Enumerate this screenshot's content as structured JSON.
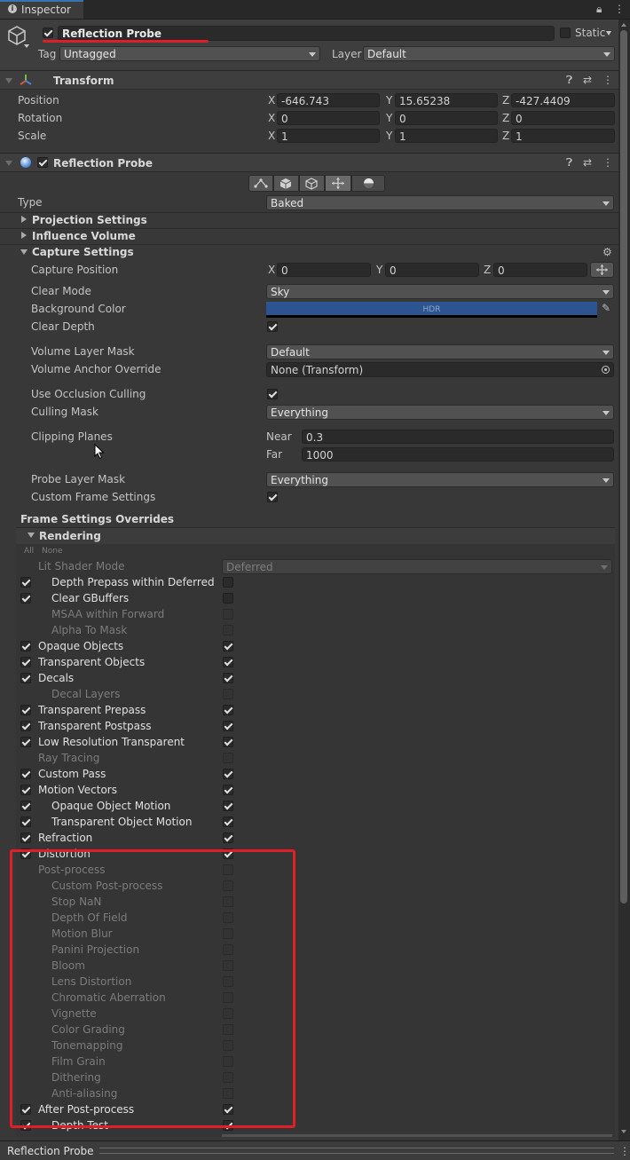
{
  "tab": {
    "title": "Inspector"
  },
  "object": {
    "enabled": true,
    "name": "Reflection Probe",
    "static_label": "Static",
    "tag_label": "Tag",
    "tag_value": "Untagged",
    "layer_label": "Layer",
    "layer_value": "Default"
  },
  "transform": {
    "title": "Transform",
    "rows": [
      {
        "label": "Position",
        "x": "-646.743",
        "y": "15.65238",
        "z": "-427.4409"
      },
      {
        "label": "Rotation",
        "x": "0",
        "y": "0",
        "z": "0"
      },
      {
        "label": "Scale",
        "x": "1",
        "y": "1",
        "z": "1"
      }
    ]
  },
  "axes": {
    "x": "X",
    "y": "Y",
    "z": "Z"
  },
  "probe": {
    "title": "Reflection Probe",
    "type_label": "Type",
    "type_value": "Baked",
    "projection": "Projection Settings",
    "influence": "Influence Volume",
    "capture": "Capture Settings",
    "capture_position": {
      "label": "Capture Position",
      "x": "0",
      "y": "0",
      "z": "0"
    },
    "clear_mode": {
      "label": "Clear Mode",
      "value": "Sky"
    },
    "background_color": {
      "label": "Background Color",
      "hdr": "HDR",
      "color": "#2c5491"
    },
    "clear_depth": "Clear Depth",
    "volume_layer_mask": {
      "label": "Volume Layer Mask",
      "value": "Default"
    },
    "volume_anchor": {
      "label": "Volume Anchor Override",
      "value": "None (Transform)"
    },
    "occlusion": "Use Occlusion Culling",
    "culling_mask": {
      "label": "Culling Mask",
      "value": "Everything"
    },
    "clipping": {
      "label": "Clipping Planes",
      "near_label": "Near",
      "near": "0.3",
      "far_label": "Far",
      "far": "1000"
    },
    "probe_layer_mask": {
      "label": "Probe Layer Mask",
      "value": "Everything"
    },
    "custom_frame": "Custom Frame Settings"
  },
  "frame": {
    "title": "Frame Settings Overrides",
    "rendering": "Rendering",
    "all": "All",
    "none": "None",
    "lit_shader": {
      "label": "Lit Shader Mode",
      "value": "Deferred"
    },
    "items": [
      {
        "label": "Depth Prepass within Deferred",
        "ov": true,
        "val": false,
        "indent": 1,
        "dim": false
      },
      {
        "label": "Clear GBuffers",
        "ov": true,
        "val": false,
        "indent": 1,
        "dim": false
      },
      {
        "label": "MSAA within Forward",
        "ov": false,
        "val": false,
        "indent": 1,
        "dim": true
      },
      {
        "label": "Alpha To Mask",
        "ov": false,
        "val": false,
        "indent": 1,
        "dim": true
      },
      {
        "label": "Opaque Objects",
        "ov": true,
        "val": true,
        "indent": 0,
        "dim": false
      },
      {
        "label": "Transparent Objects",
        "ov": true,
        "val": true,
        "indent": 0,
        "dim": false
      },
      {
        "label": "Decals",
        "ov": true,
        "val": true,
        "indent": 0,
        "dim": false
      },
      {
        "label": "Decal Layers",
        "ov": false,
        "val": false,
        "indent": 1,
        "dim": true
      },
      {
        "label": "Transparent Prepass",
        "ov": true,
        "val": true,
        "indent": 0,
        "dim": false
      },
      {
        "label": "Transparent Postpass",
        "ov": true,
        "val": true,
        "indent": 0,
        "dim": false
      },
      {
        "label": "Low Resolution Transparent",
        "ov": true,
        "val": true,
        "indent": 0,
        "dim": false
      },
      {
        "label": "Ray Tracing",
        "ov": false,
        "val": false,
        "indent": 0,
        "dim": true
      },
      {
        "label": "Custom Pass",
        "ov": true,
        "val": true,
        "indent": 0,
        "dim": false
      },
      {
        "label": "Motion Vectors",
        "ov": true,
        "val": true,
        "indent": 0,
        "dim": false
      },
      {
        "label": "Opaque Object Motion",
        "ov": true,
        "val": true,
        "indent": 1,
        "dim": false
      },
      {
        "label": "Transparent Object Motion",
        "ov": true,
        "val": true,
        "indent": 1,
        "dim": false
      },
      {
        "label": "Refraction",
        "ov": true,
        "val": true,
        "indent": 0,
        "dim": false
      },
      {
        "label": "Distortion",
        "ov": true,
        "val": true,
        "indent": 0,
        "dim": false
      },
      {
        "label": "Post-process",
        "ov": false,
        "val": false,
        "indent": 0,
        "dim": true
      },
      {
        "label": "Custom Post-process",
        "ov": false,
        "val": false,
        "indent": 1,
        "dim": true
      },
      {
        "label": "Stop NaN",
        "ov": false,
        "val": false,
        "indent": 1,
        "dim": true
      },
      {
        "label": "Depth Of Field",
        "ov": false,
        "val": false,
        "indent": 1,
        "dim": true
      },
      {
        "label": "Motion Blur",
        "ov": false,
        "val": false,
        "indent": 1,
        "dim": true
      },
      {
        "label": "Panini Projection",
        "ov": false,
        "val": false,
        "indent": 1,
        "dim": true
      },
      {
        "label": "Bloom",
        "ov": false,
        "val": false,
        "indent": 1,
        "dim": true
      },
      {
        "label": "Lens Distortion",
        "ov": false,
        "val": false,
        "indent": 1,
        "dim": true
      },
      {
        "label": "Chromatic Aberration",
        "ov": false,
        "val": false,
        "indent": 1,
        "dim": true
      },
      {
        "label": "Vignette",
        "ov": false,
        "val": false,
        "indent": 1,
        "dim": true
      },
      {
        "label": "Color Grading",
        "ov": false,
        "val": false,
        "indent": 1,
        "dim": true
      },
      {
        "label": "Tonemapping",
        "ov": false,
        "val": false,
        "indent": 1,
        "dim": true
      },
      {
        "label": "Film Grain",
        "ov": false,
        "val": false,
        "indent": 1,
        "dim": true
      },
      {
        "label": "Dithering",
        "ov": false,
        "val": false,
        "indent": 1,
        "dim": true
      },
      {
        "label": "Anti-aliasing",
        "ov": false,
        "val": false,
        "indent": 1,
        "dim": true
      },
      {
        "label": "After Post-process",
        "ov": true,
        "val": true,
        "indent": 0,
        "dim": false
      },
      {
        "label": "Depth Test",
        "ov": true,
        "val": true,
        "indent": 1,
        "dim": false
      }
    ]
  },
  "footer": {
    "title": "Reflection Probe"
  },
  "colors": {
    "highlight": "#e01e25",
    "accent": "#2c5491",
    "background": "#383838"
  }
}
